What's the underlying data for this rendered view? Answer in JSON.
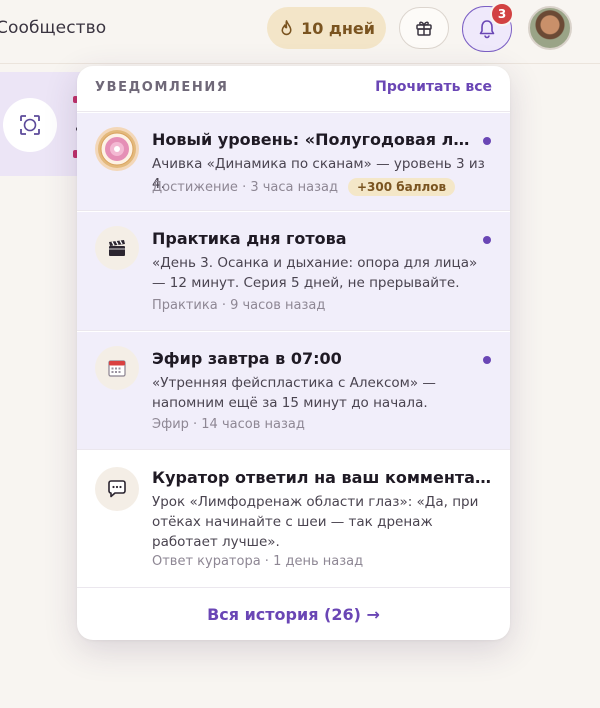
{
  "topbar": {
    "nav_community": "Сообщество",
    "streak_label": "10 дней",
    "notifications_count": "3"
  },
  "panel": {
    "title": "УВЕДОМЛЕНИЯ",
    "mark_all_read": "Прочитать все",
    "footer_link": "Вся история (26) →"
  },
  "notifications": [
    {
      "title": "Новый уровень: «Полугодовая линия»",
      "body": "Ачивка «Динамика по сканам» — уровень 3 из 4.",
      "meta": "Достижение · 3 часа назад",
      "badge": "+300 баллов",
      "unread": true,
      "icon": "achievement-medal-icon"
    },
    {
      "title": "Практика дня готова",
      "body": "«День 3. Осанка и дыхание: опора для лица» — 12 минут. Серия 5 дней, не прерывайте.",
      "meta": "Практика · 9 часов назад",
      "unread": true,
      "icon": "clapperboard-icon"
    },
    {
      "title": "Эфир завтра в 07:00",
      "body": "«Утренняя фейспластика с Алексом» — напомним ещё за 15 минут до начала.",
      "meta": "Эфир · 14 часов назад",
      "unread": true,
      "icon": "calendar-icon"
    },
    {
      "title": "Куратор ответил на ваш комментарий",
      "body": "Урок «Лимфодренаж области глаз»: «Да, при отёках начинайте с шеи — так дренаж работает лучше».",
      "meta": "Ответ куратора · 1 день назад",
      "unread": false,
      "icon": "chat-bubble-icon"
    }
  ],
  "colors": {
    "accent": "#6a46b5",
    "badge_red": "#d24242",
    "unread_bg": "#f1eefa",
    "streak_bg": "#f3e5c8"
  }
}
